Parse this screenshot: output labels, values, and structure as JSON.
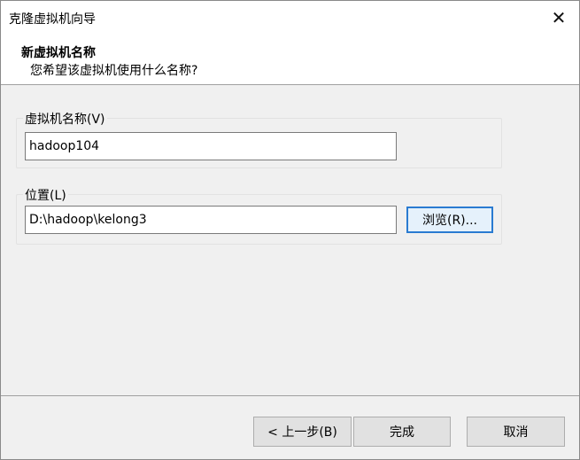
{
  "window": {
    "title": "克隆虚拟机向导",
    "close_glyph": "✕"
  },
  "header": {
    "heading": "新虚拟机名称",
    "subheading": "您希望该虚拟机使用什么名称?"
  },
  "name_group": {
    "label": "虚拟机名称(V)",
    "value": "hadoop104"
  },
  "location_group": {
    "label": "位置(L)",
    "value": "D:\\hadoop\\kelong3",
    "browse_label": "浏览(R)..."
  },
  "footer": {
    "back_label": "< 上一步(B)",
    "finish_label": "完成",
    "cancel_label": "取消"
  },
  "icons": {
    "close": "close-icon"
  },
  "colors": {
    "accent": "#2a7bd1",
    "dialog_bg": "#f0f0f0",
    "header_bg": "#ffffff"
  }
}
